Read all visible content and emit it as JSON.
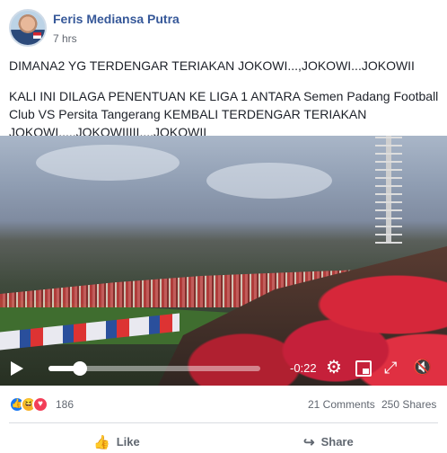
{
  "post": {
    "author": "Feris Mediansa Putra",
    "time": "7 hrs",
    "text_line1": "DIMANA2 YG TERDENGAR TERIAKAN JOKOWI...,JOKOWI...JOKOWII",
    "text_line2": "KALI INI DILAGA PENENTUAN KE LIGA 1 ANTARA Semen Padang Football Club VS Persita Tangerang KEMBALI TERDENGAR TERIAKAN JOKOWI.....JOKOWIIIII...,JOKOWII"
  },
  "video": {
    "time_remaining": "-0:22",
    "progress": 0.15
  },
  "stats": {
    "reaction_count": "186",
    "comments": "21 Comments",
    "shares": "250 Shares"
  },
  "actions": {
    "like": "Like",
    "share": "Share"
  },
  "icons": {
    "like": "thumbs-up-icon",
    "share": "share-arrow-icon",
    "settings": "gear-icon"
  }
}
